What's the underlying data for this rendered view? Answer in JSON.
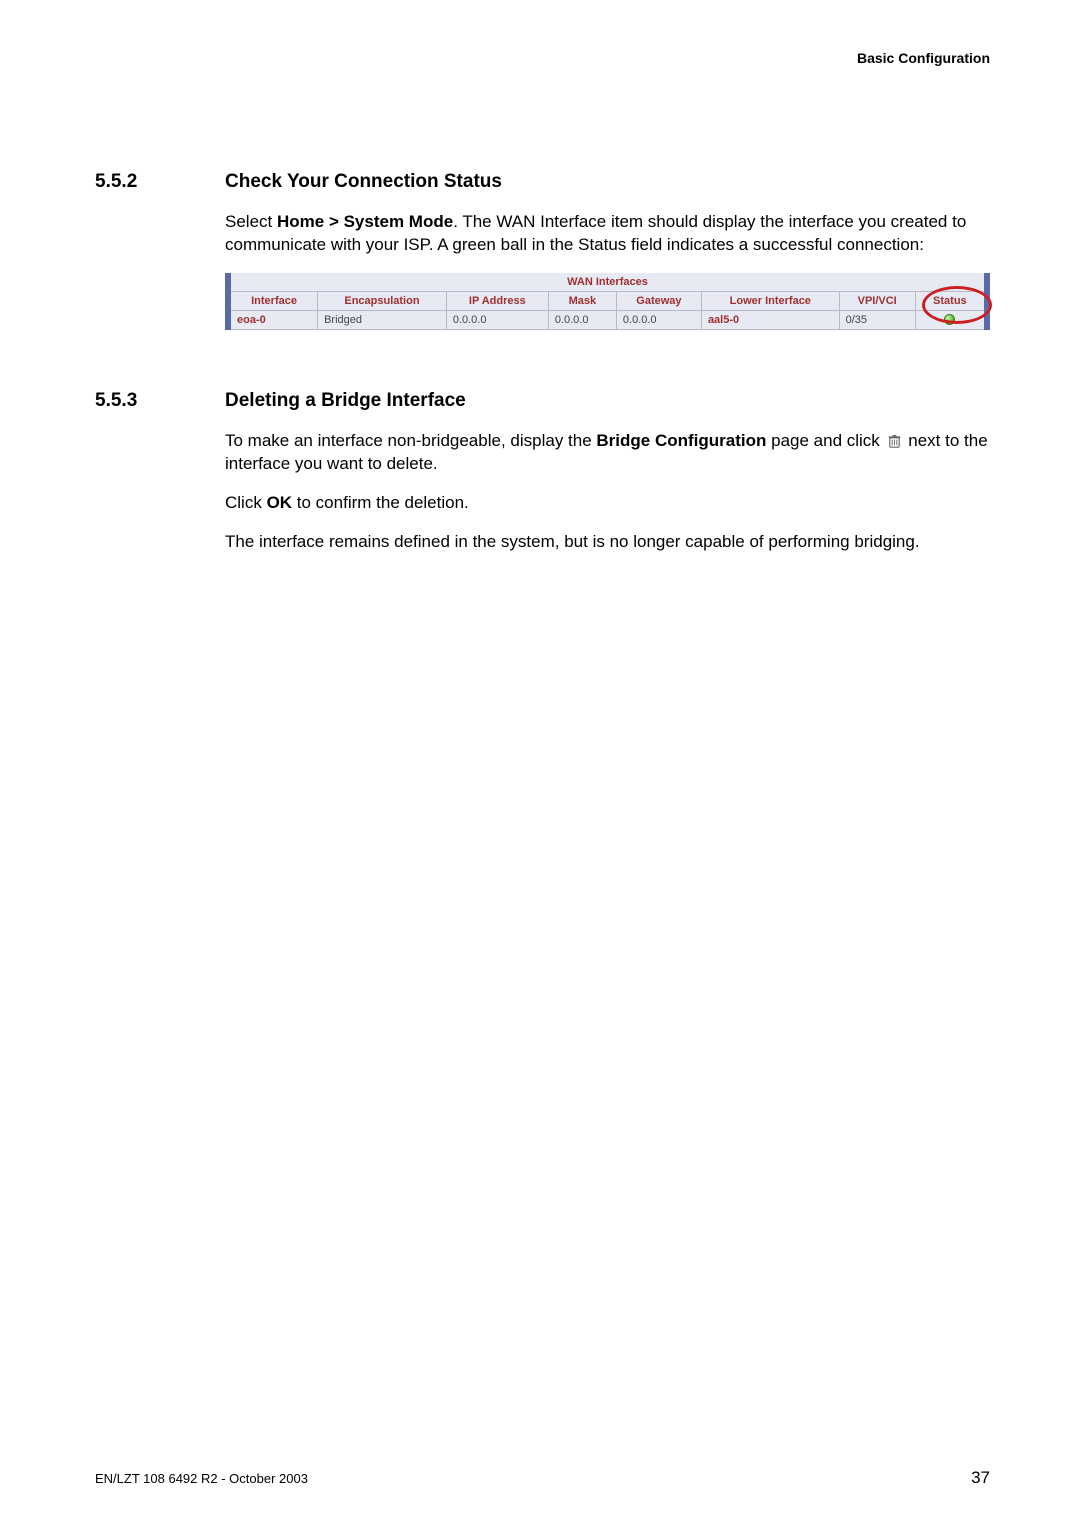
{
  "header": {
    "right": "Basic Configuration"
  },
  "sec1": {
    "num": "5.5.2",
    "title": "Check Your Connection Status",
    "p1_a": "Select ",
    "p1_b": "Home > System Mode",
    "p1_c": ". The WAN Interface item should display the interface you created to communicate with your ISP. A green ball in the Status field indicates a successful connection:"
  },
  "wan": {
    "title": "WAN Interfaces",
    "headers": {
      "iface": "Interface",
      "encap": "Encapsulation",
      "ip": "IP Address",
      "mask": "Mask",
      "gw": "Gateway",
      "lower": "Lower Interface",
      "vpi": "VPI/VCI",
      "status": "Status"
    },
    "row": {
      "iface": "eoa-0",
      "encap": "Bridged",
      "ip": "0.0.0.0",
      "mask": "0.0.0.0",
      "gw": "0.0.0.0",
      "lower": "aal5-0",
      "vpi": "0/35"
    }
  },
  "sec2": {
    "num": "5.5.3",
    "title": "Deleting a Bridge Interface",
    "p1_a": "To make an interface non-bridgeable, display the ",
    "p1_b": "Bridge Configuration",
    "p1_c": " page and click ",
    "p1_d": " next to the interface you want to delete.",
    "p2_a": "Click ",
    "p2_b": "OK",
    "p2_c": " to confirm the deletion.",
    "p3": "The interface remains defined in the system, but is no longer capable of performing bridging."
  },
  "footer": {
    "left": "EN/LZT 108 6492 R2 - October 2003",
    "right": "37"
  }
}
